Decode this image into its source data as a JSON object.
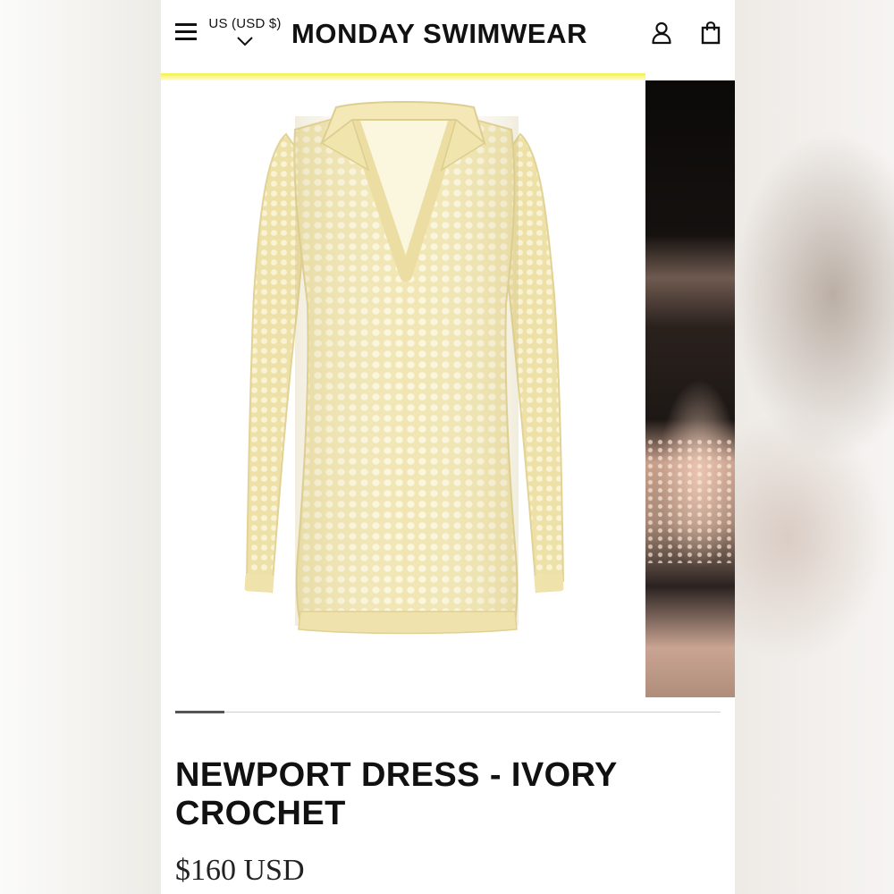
{
  "header": {
    "menu_icon": "hamburger-menu-icon",
    "currency_label": "US (USD $)",
    "currency_icon": "chevron-down-icon",
    "brand": "MONDAY SWIMWEAR",
    "account_icon": "user-account-icon",
    "bag_icon": "shopping-bag-icon",
    "accent_color": "#f4f04a"
  },
  "gallery": {
    "images": [
      {
        "description": "Ivory crochet long-sleeve collared mini dress product shot"
      },
      {
        "description": "Model wearing dress on beach (partially visible)"
      }
    ],
    "progress": 0.09
  },
  "product": {
    "title": "NEWPORT DRESS - IVORY CROCHET",
    "price": "$160 USD"
  },
  "colors": {
    "dress": "#f3e9b9",
    "dress_shadow": "#d9cc92"
  }
}
